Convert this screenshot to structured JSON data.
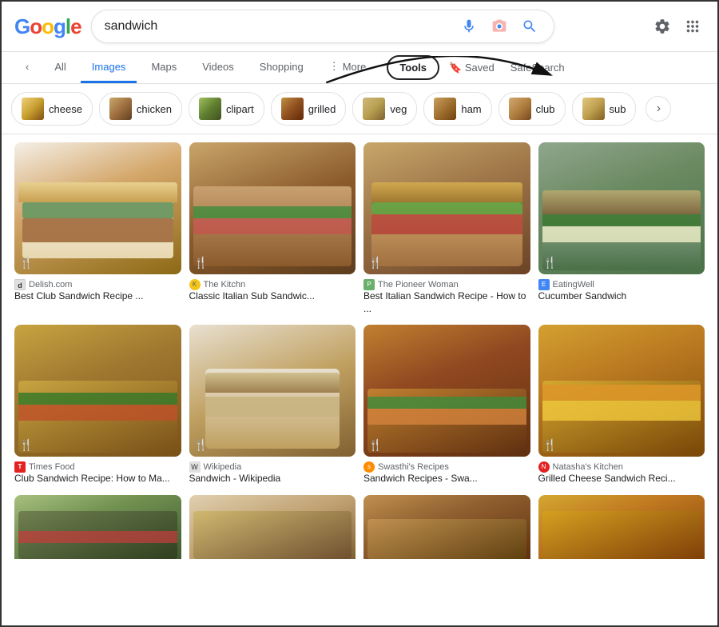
{
  "header": {
    "logo_text": "Google",
    "search_query": "sandwich",
    "mic_icon": "microphone-icon",
    "lens_icon": "camera-icon",
    "search_icon": "search-icon",
    "settings_icon": "settings-icon",
    "apps_icon": "apps-icon"
  },
  "nav": {
    "back_label": "‹",
    "all_label": "All",
    "images_label": "Images",
    "maps_label": "Maps",
    "videos_label": "Videos",
    "shopping_label": "Shopping",
    "more_label": "More",
    "tools_label": "Tools",
    "saved_label": "Saved",
    "safesearch_label": "SafeSearch"
  },
  "filters": {
    "chips": [
      {
        "label": "cheese"
      },
      {
        "label": "chicken"
      },
      {
        "label": "clipart"
      },
      {
        "label": "grilled"
      },
      {
        "label": "veg"
      },
      {
        "label": "ham"
      },
      {
        "label": "club"
      },
      {
        "label": "sub"
      }
    ],
    "next_icon": "›"
  },
  "images": {
    "row1": [
      {
        "source": "Delish.com",
        "title": "Best Club Sandwich Recipe ...",
        "favicon_class": "fav-delish",
        "fav_letter": "d"
      },
      {
        "source": "The Kitchn",
        "title": "Classic Italian Sub Sandwic...",
        "favicon_class": "fav-kitchn",
        "fav_letter": "k"
      },
      {
        "source": "The Pioneer Woman",
        "title": "Best Italian Sandwich Recipe - How to ...",
        "favicon_class": "fav-pioneer",
        "fav_letter": "p"
      },
      {
        "source": "EatingWell",
        "title": "Cucumber Sandwich",
        "favicon_class": "fav-eatingwell",
        "fav_letter": "e"
      }
    ],
    "row2": [
      {
        "source": "Times Food",
        "title": "Club Sandwich Recipe: How to Ma...",
        "favicon_class": "fav-timesfood",
        "fav_letter": "T"
      },
      {
        "source": "Wikipedia",
        "title": "Sandwich - Wikipedia",
        "favicon_class": "fav-wiki",
        "fav_letter": "W"
      },
      {
        "source": "Swasthi's Recipes",
        "title": "Sandwich Recipes - Swa...",
        "favicon_class": "fav-swasthi",
        "fav_letter": "s"
      },
      {
        "source": "Natasha's Kitchen",
        "title": "Grilled Cheese Sandwich Reci...",
        "favicon_class": "fav-natasha",
        "fav_letter": "N"
      }
    ],
    "row3_count": 4
  },
  "colors": {
    "google_blue": "#4285F4",
    "google_red": "#EA4335",
    "google_yellow": "#FBBC05",
    "google_green": "#34A853",
    "active_tab": "#1a73e8"
  }
}
